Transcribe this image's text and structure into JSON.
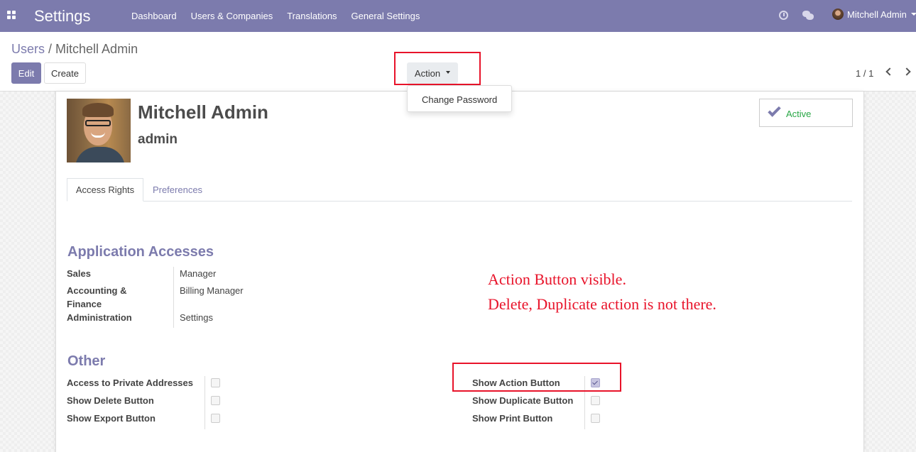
{
  "navbar": {
    "app_title": "Settings",
    "menu": [
      "Dashboard",
      "Users & Companies",
      "Translations",
      "General Settings"
    ],
    "user_name": "Mitchell Admin"
  },
  "breadcrumb": {
    "parent": "Users",
    "separator": "/",
    "current": "Mitchell Admin"
  },
  "buttons": {
    "edit": "Edit",
    "create": "Create",
    "action": "Action"
  },
  "action_menu": {
    "items": [
      "Change Password"
    ]
  },
  "pager": {
    "value": "1 / 1"
  },
  "record": {
    "name": "Mitchell Admin",
    "login": "admin",
    "status": "Active"
  },
  "tabs": [
    "Access Rights",
    "Preferences"
  ],
  "application_accesses": {
    "title": "Application Accesses",
    "rows": [
      {
        "label": "Sales",
        "value": "Manager"
      },
      {
        "label": "Accounting & Finance",
        "value": "Billing Manager"
      },
      {
        "label": "Administration",
        "value": "Settings"
      }
    ]
  },
  "other": {
    "title": "Other",
    "left": [
      {
        "label": "Access to Private Addresses",
        "checked": false
      },
      {
        "label": "Show Delete Button",
        "checked": false
      },
      {
        "label": "Show Export Button",
        "checked": false
      }
    ],
    "right": [
      {
        "label": "Show Action Button",
        "checked": true
      },
      {
        "label": "Show Duplicate Button",
        "checked": false
      },
      {
        "label": "Show Print Button",
        "checked": false
      }
    ]
  },
  "annotation": {
    "line1": "Action Button visible.",
    "line2": "Delete, Duplicate action is not there."
  },
  "colors": {
    "brand": "#7c7bad",
    "annotation": "#e8132a",
    "active": "#28a745"
  }
}
